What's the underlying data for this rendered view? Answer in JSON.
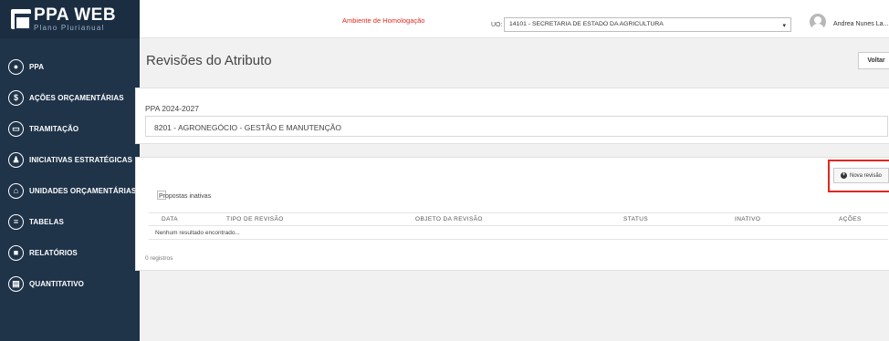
{
  "app": {
    "logo_title": "PPA WEB",
    "logo_subtitle": "Plano Plurianual"
  },
  "sidebar": {
    "items": [
      {
        "label": "PPA",
        "icon": "ppa-icon",
        "glyph": "●"
      },
      {
        "label": "AÇÕES ORÇAMENTÁRIAS",
        "icon": "dollar-icon",
        "glyph": "$"
      },
      {
        "label": "TRAMITAÇÃO",
        "icon": "inbox-icon",
        "glyph": "▭"
      },
      {
        "label": "INICIATIVAS ESTRATÉGICAS",
        "icon": "strategy-icon",
        "glyph": "♟"
      },
      {
        "label": "UNIDADES ORÇAMENTÁRIAS",
        "icon": "bank-icon",
        "glyph": "⌂"
      },
      {
        "label": "TABELAS",
        "icon": "table-icon",
        "glyph": "≡"
      },
      {
        "label": "RELATÓRIOS",
        "icon": "report-icon",
        "glyph": "■"
      },
      {
        "label": "QUANTITATIVO",
        "icon": "chart-icon",
        "glyph": "▤"
      }
    ]
  },
  "topbar": {
    "environment": "Ambiente de Homologação",
    "uo_label": "UO:",
    "uo_value": "14101 - SECRETARIA DE ESTADO DA AGRICULTURA",
    "user_name": "Andrea Nunes La..."
  },
  "page": {
    "title": "Revisões do Atributo",
    "back_label": "Voltar"
  },
  "ppa_card": {
    "period": "PPA 2024-2027",
    "program": "8201 - AGRONEGÓCIO - GESTÃO E MANUTENÇÃO"
  },
  "revisions": {
    "new_button": "Nova revisão",
    "checkbox_label": "Propostas inativas",
    "columns": [
      "DATA",
      "TIPO DE REVISÃO",
      "OBJETO DA REVISÃO",
      "STATUS",
      "INATIVO",
      "AÇÕES"
    ],
    "empty_message": "Nenhum resultado encontrado...",
    "records_count": "0 registros"
  },
  "colors": {
    "sidebar": "#1f3349",
    "environment": "#e0281f",
    "highlight": "#e0281f"
  }
}
